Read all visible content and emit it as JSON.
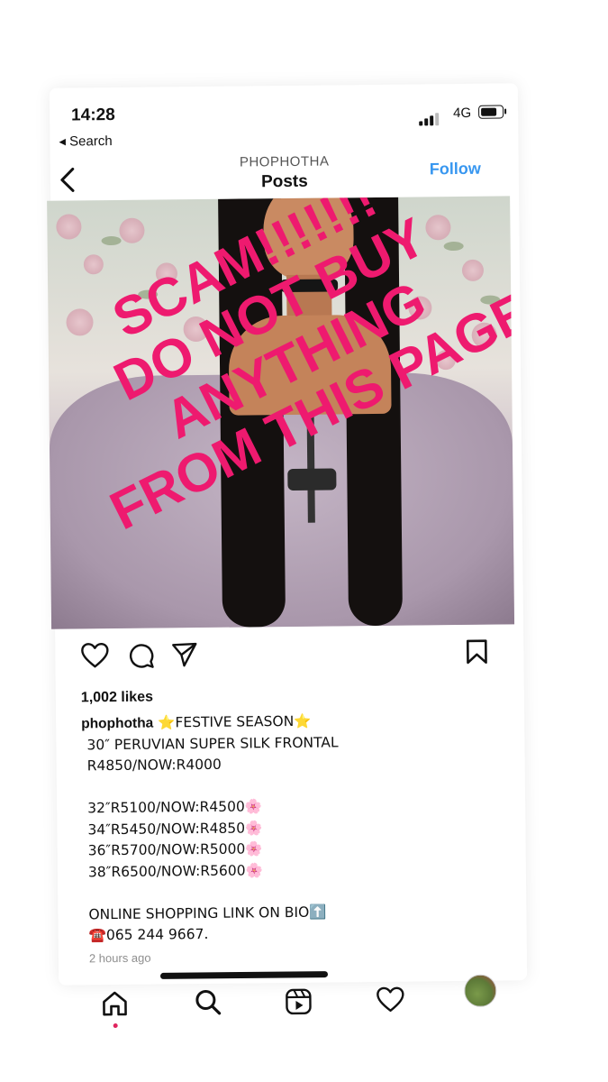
{
  "status_bar": {
    "time": "14:28",
    "back_app": "◂ Search",
    "network": "4G"
  },
  "header": {
    "account": "PHOPHOTHA",
    "title": "Posts",
    "follow_label": "Follow"
  },
  "post": {
    "overlay_lines": [
      "SCAM!!!!!!!",
      "DO NOT BUY",
      "ANYTHING",
      "FROM THIS PAGE"
    ],
    "overlay_color": "#ee1a6f",
    "likes": "1,002 likes",
    "username": "phophotha",
    "caption_first": " ⭐FESTIVE SEASON⭐",
    "caption_lines": [
      "30″ PERUVIAN SUPER SILK FRONTAL",
      "R4850/NOW:R4000",
      "",
      "32″R5100/NOW:R4500🌸",
      "34″R5450/NOW:R4850🌸",
      "36″R5700/NOW:R5000🌸",
      "38″R6500/NOW:R5600🌸",
      "",
      "ONLINE SHOPPING LINK ON BIO⬆️",
      "☎️065 244 9667."
    ],
    "time_ago": "2 hours ago"
  },
  "icons": {
    "back": "chevron-left-icon",
    "like": "heart-icon",
    "comment": "comment-icon",
    "share": "paper-plane-icon",
    "save": "bookmark-icon",
    "home": "home-icon",
    "search": "search-icon",
    "reels": "reels-icon",
    "activity": "heart-icon"
  },
  "colors": {
    "accent": "#3897f0",
    "overlay": "#ee1a6f"
  }
}
